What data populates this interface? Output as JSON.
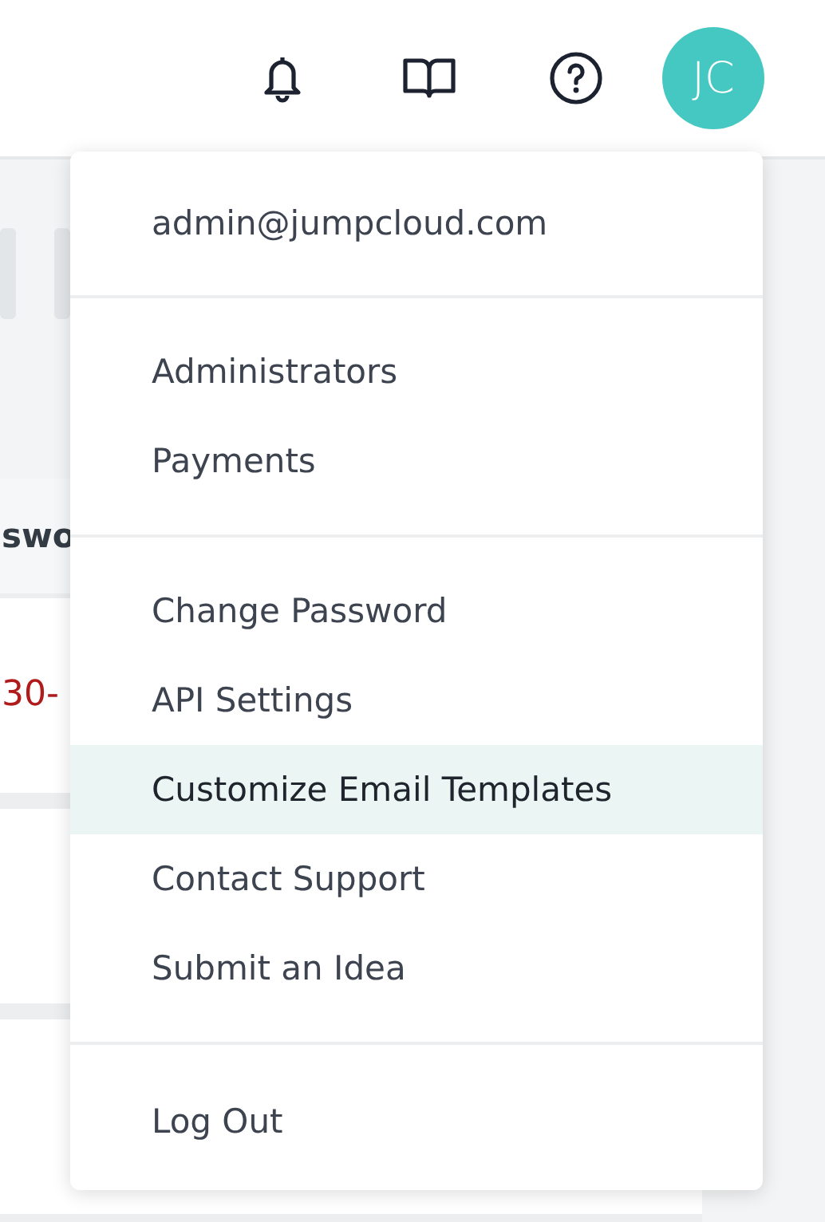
{
  "header": {
    "avatar": "JC"
  },
  "background": {
    "column_header": "swo",
    "rows": [
      {
        "cell": "30-"
      },
      {
        "cell": ""
      },
      {
        "cell": ""
      }
    ]
  },
  "user_menu": {
    "email": "admin@jumpcloud.com",
    "sections": [
      [
        {
          "label": "Administrators",
          "selected": false
        },
        {
          "label": "Payments",
          "selected": false
        }
      ],
      [
        {
          "label": "Change Password",
          "selected": false
        },
        {
          "label": "API Settings",
          "selected": false
        },
        {
          "label": "Customize Email Templates",
          "selected": true
        },
        {
          "label": "Contact Support",
          "selected": false
        },
        {
          "label": "Submit an Idea",
          "selected": false
        }
      ],
      [
        {
          "label": "Log Out",
          "selected": false
        }
      ]
    ]
  }
}
